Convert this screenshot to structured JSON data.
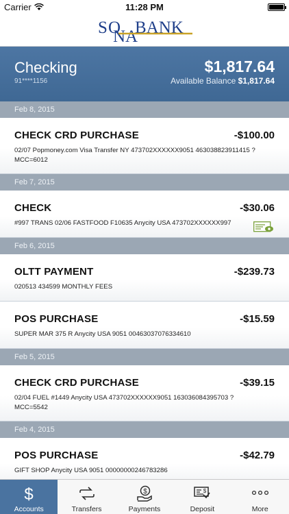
{
  "status_bar": {
    "carrier": "Carrier",
    "time": "11:28 PM"
  },
  "nav": {
    "logo_text_main": "BANK",
    "logo_text_s": "S",
    "logo_text_o": "O",
    "logo_text_na": "NA"
  },
  "account": {
    "name": "Checking",
    "number": "91****1156",
    "balance": "$1,817.64",
    "available_label": "Available Balance",
    "available_value": "$1,817.64"
  },
  "transactions": [
    {
      "date": "Feb 8, 2015"
    },
    {
      "title": "CHECK CRD PURCHASE",
      "amount": "-$100.00",
      "desc": "02/07 Popmoney.com Visa Transfer NY 473702XXXXXX9051 463038823911415 ? MCC=6012"
    },
    {
      "date": "Feb 7, 2015"
    },
    {
      "title": "CHECK",
      "amount": "-$30.06",
      "desc": "#997 TRANS 02/06 FASTFOOD F10635 Anycity USA 473702XXXXXX997"
    },
    {
      "date": "Feb 6, 2015"
    },
    {
      "title": "OLTT PAYMENT",
      "amount": "-$239.73",
      "desc": "020513 434599 MONTHLY FEES"
    },
    {
      "title": "POS PURCHASE",
      "amount": "-$15.59",
      "desc": "SUPER MAR 375 R Anycity USA 9051 00463037076334610"
    },
    {
      "date": "Feb 5, 2015"
    },
    {
      "title": "CHECK CRD PURCHASE",
      "amount": "-$39.15",
      "desc": "02/04 FUEL #1449 Anycity USA 473702XXXXXX9051 163036084395703 ? MCC=5542"
    },
    {
      "date": "Feb 4, 2015"
    },
    {
      "title": "POS PURCHASE",
      "amount": "-$42.79",
      "desc": "GIFT SHOP Anycity USA 9051 00000000246783286"
    }
  ],
  "tabs": [
    {
      "label": "Accounts",
      "icon": "dollar-icon"
    },
    {
      "label": "Transfers",
      "icon": "transfer-icon"
    },
    {
      "label": "Payments",
      "icon": "payment-icon"
    },
    {
      "label": "Deposit",
      "icon": "check-deposit-icon"
    },
    {
      "label": "More",
      "icon": "more-icon"
    }
  ],
  "colors": {
    "header": "#4a73a0",
    "date_band": "#9ba7b4",
    "active_tab": "#4a73a0",
    "logo_blue": "#1f3f8a",
    "logo_gold": "#c9a227"
  }
}
